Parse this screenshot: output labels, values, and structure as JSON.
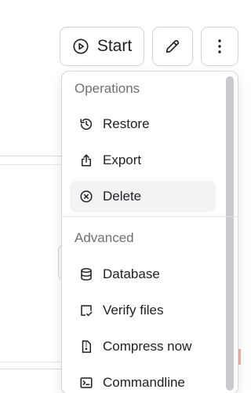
{
  "toolbar": {
    "start_label": "Start",
    "start_icon": "play-circle-icon",
    "edit_icon": "pencil-icon",
    "more_icon": "vertical-ellipsis-icon"
  },
  "menu": {
    "sections": [
      {
        "title": "Operations",
        "items": [
          {
            "label": "Restore",
            "icon": "history-icon"
          },
          {
            "label": "Export",
            "icon": "share-icon"
          },
          {
            "label": "Delete",
            "icon": "circle-x-icon",
            "highlighted": true
          }
        ]
      },
      {
        "title": "Advanced",
        "items": [
          {
            "label": "Database",
            "icon": "database-icon"
          },
          {
            "label": "Verify files",
            "icon": "file-check-icon"
          },
          {
            "label": "Compress now",
            "icon": "file-zip-icon"
          },
          {
            "label": "Commandline",
            "icon": "terminal-icon"
          }
        ]
      }
    ]
  },
  "colors": {
    "text": "#1f1f24",
    "muted": "#6f6f76",
    "border": "#d3d3d8",
    "hover": "#f3f3f5",
    "scrollbar": "#c9c9ce"
  }
}
